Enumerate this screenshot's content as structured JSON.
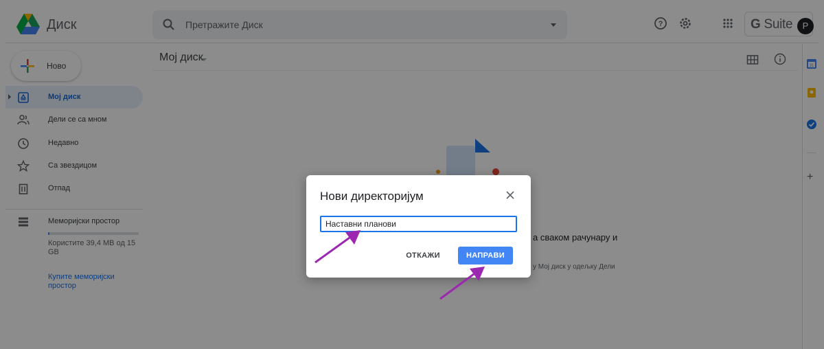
{
  "header": {
    "app_title": "Диск",
    "search_placeholder": "Претражите Диск",
    "suite_bold": "G",
    "suite_rest": " Suite",
    "avatar_letter": "P"
  },
  "sidebar": {
    "new_label": "Ново",
    "items": [
      {
        "label": "Мој диск",
        "icon": "drive-icon",
        "active": true
      },
      {
        "label": "Дели се са мном",
        "icon": "shared-users-icon"
      },
      {
        "label": "Недавно",
        "icon": "clock-icon"
      },
      {
        "label": "Са звездицом",
        "icon": "star-icon"
      },
      {
        "label": "Отпад",
        "icon": "trash-icon"
      }
    ],
    "storage_label": "Меморијски простор",
    "storage_usage": "Користите 39,4 MB од 15 GB",
    "buy_storage": "Купите меморијски простор",
    "storage_used_fraction": 0.003
  },
  "main": {
    "breadcrumb": "Мој диск",
    "empty_title_fragment": "а сваком рачунару и",
    "empty_desc_fragment": "у Мој диск у одељку Дели"
  },
  "dialog": {
    "title": "Нови директоријум",
    "input_value": "Наставни планови",
    "cancel_label": "ОТКАЖИ",
    "create_label": "НАПРАВИ"
  },
  "colors": {
    "accent": "#1a73e8",
    "primary_button": "#4285f4",
    "active_nav_bg": "#e8f0fe",
    "annotation_arrow": "#9c27b0"
  }
}
